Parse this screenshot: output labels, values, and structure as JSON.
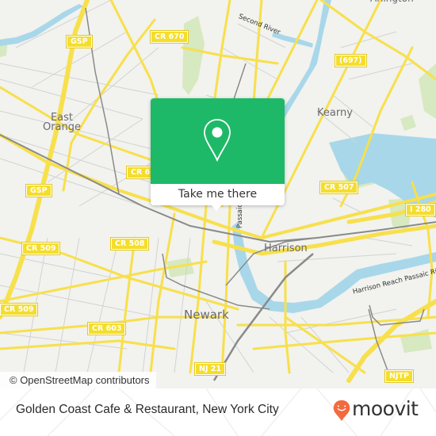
{
  "map": {
    "colors": {
      "land": "#f2f2ee",
      "water": "#a8d7ea",
      "park": "#d6e9c0",
      "major_road": "#f7e04b",
      "minor_road": "#cfcfcf",
      "rail": "#8a8a8a"
    },
    "places": [
      {
        "id": "east-orange",
        "label": "East\nOrange"
      },
      {
        "id": "kearny",
        "label": "Kearny"
      },
      {
        "id": "harrison",
        "label": "Harrison"
      },
      {
        "id": "newark",
        "label": "Newark"
      },
      {
        "id": "arlington",
        "label": "Arlington"
      }
    ],
    "road_shields": [
      {
        "id": "gsp-1",
        "label": "GSP"
      },
      {
        "id": "cr670",
        "label": "CR 670"
      },
      {
        "id": "r697",
        "label": "(697)"
      },
      {
        "id": "cr6xx",
        "label": "CR 6"
      },
      {
        "id": "gsp-2",
        "label": "GSP"
      },
      {
        "id": "cr507",
        "label": "CR 507"
      },
      {
        "id": "i280",
        "label": "I 280"
      },
      {
        "id": "cr509-1",
        "label": "CR 509"
      },
      {
        "id": "cr508",
        "label": "CR 508"
      },
      {
        "id": "cr509-2",
        "label": "CR 509"
      },
      {
        "id": "cr603",
        "label": "CR 603"
      },
      {
        "id": "nj21",
        "label": "NJ 21"
      },
      {
        "id": "njtp",
        "label": "NJTP"
      }
    ],
    "river_labels": [
      {
        "id": "second-river",
        "label": "Second River"
      },
      {
        "id": "passaic-river",
        "label": "Passaic River"
      },
      {
        "id": "harrison-reach",
        "label": "Harrison Reach Passaic River"
      }
    ],
    "attribution": "© OpenStreetMap contributors"
  },
  "popup": {
    "icon": "location-pin-icon",
    "cta_label": "Take me there",
    "accent_color": "#1eb968"
  },
  "footer": {
    "title": "Golden Coast Cafe & Restaurant, New York City",
    "brand": "moovit",
    "brand_color": "#f26a3d"
  }
}
